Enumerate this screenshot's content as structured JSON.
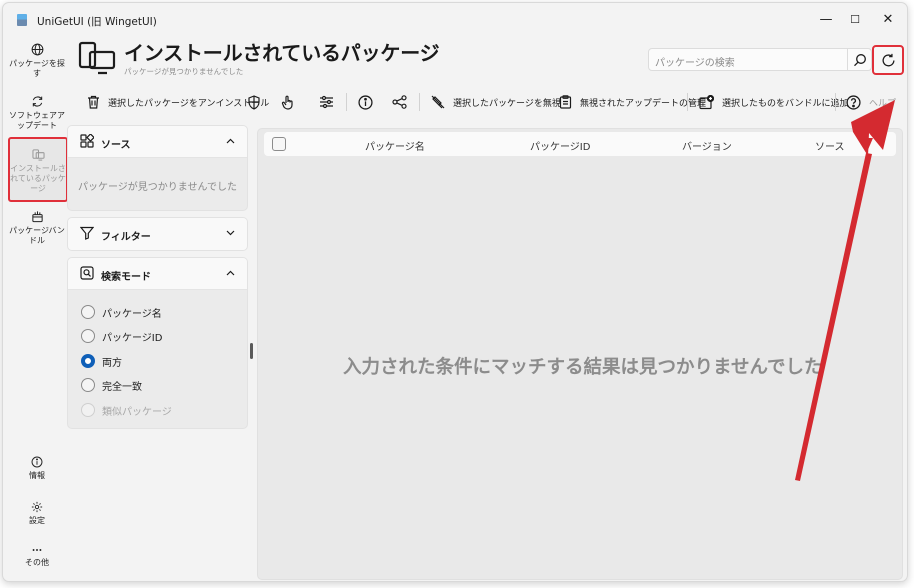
{
  "window": {
    "title": "UniGetUI (旧 WingetUI)",
    "controls": {
      "minimize": "—",
      "maximize": "☐",
      "close": "✕"
    }
  },
  "nav": [
    {
      "label": "パッケージを探す",
      "icon": "globe-icon"
    },
    {
      "label": "ソフトウェアアップデート",
      "icon": "refresh-icon"
    },
    {
      "label": "インストールされているパッケージ",
      "icon": "installed-icon",
      "selected": true
    },
    {
      "label": "パッケージバンドル",
      "icon": "bundle-icon"
    },
    {
      "label": "情報",
      "icon": "info-icon"
    },
    {
      "label": "設定",
      "icon": "gear-icon"
    },
    {
      "label": "その他",
      "icon": "more-icon"
    }
  ],
  "header": {
    "title": "インストールされているパッケージ",
    "subtitle": "パッケージが見つかりませんでした",
    "search_placeholder": "パッケージの検索"
  },
  "toolbar": {
    "uninstall_label": "選択したパッケージをアンインストール",
    "ignore_label": "選択したパッケージを無視",
    "manage_ignored_label": "無視されたアップデートの管理",
    "add_bundle_label": "選択したものをバンドルに追加",
    "help_label": "ヘルプ"
  },
  "sources": {
    "title": "ソース",
    "empty": "パッケージが見つかりませんでした"
  },
  "filters": {
    "title": "フィルター"
  },
  "search_mode": {
    "title": "検索モード",
    "options": [
      "パッケージ名",
      "パッケージID",
      "両方",
      "完全一致",
      "類似パッケージ"
    ],
    "selected": "両方",
    "disabled": "類似パッケージ"
  },
  "table": {
    "columns": [
      "パッケージ名",
      "パッケージID",
      "バージョン",
      "ソース"
    ],
    "empty_message": "入力された条件にマッチする結果は見つかりませんでした"
  },
  "colors": {
    "accent": "#0f5fb8",
    "highlight": "#e0303a",
    "background": "#f3f3f3"
  }
}
